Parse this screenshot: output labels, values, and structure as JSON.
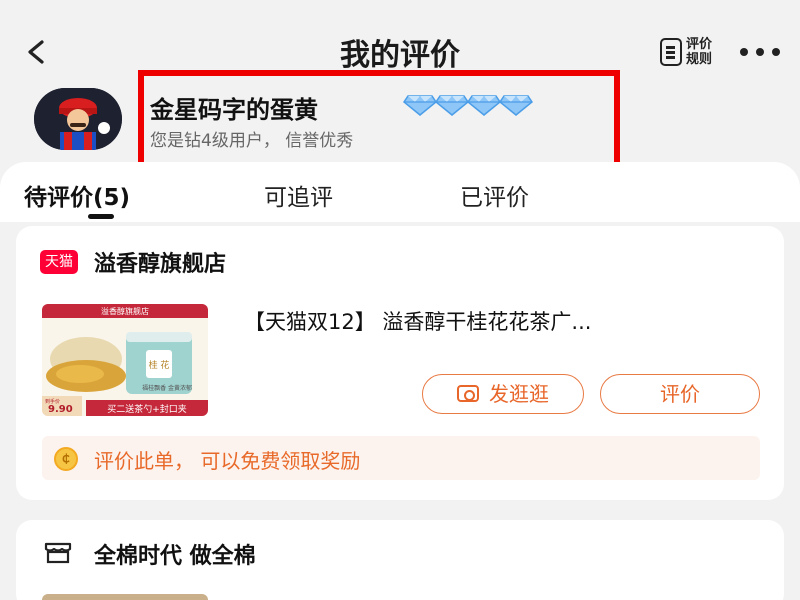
{
  "header": {
    "title": "我的评价",
    "rules_label": "评价\n规则",
    "back_icon": "chevron-left-icon",
    "more_icon": "more-dots-icon"
  },
  "user": {
    "name": "金星码字的蛋黄",
    "level_text": "您是钻4级用户， 信誉优秀",
    "diamond_count": 4,
    "diamond_color": "#5aa8f0",
    "highlight_color": "#ee0000"
  },
  "tabs": [
    {
      "label": "待评价(5)",
      "active": true
    },
    {
      "label": "可追评",
      "active": false
    },
    {
      "label": "已评价",
      "active": false
    }
  ],
  "orders": [
    {
      "shop_badge": "天猫",
      "shop_name": "溢香醇旗舰店",
      "product_title": "【天猫双12】 溢香醇干桂花花茶广...",
      "image": {
        "banner": "溢香醇旗舰店",
        "price_label": "到手价",
        "price": "9.90",
        "promo": "买二送茶勺+封口夹",
        "tin_label": "桂 花",
        "tin_side": "福桂飘香 金黄浓郁"
      },
      "share_button": "发逛逛",
      "review_button": "评价",
      "reward_text": "评价此单， 可以免费领取奖励"
    },
    {
      "shop_name": "全棉时代 做全棉"
    }
  ],
  "colors": {
    "accent": "#e8662a",
    "tmall_red": "#ff0036",
    "reward_bg": "#fdf3ee"
  }
}
